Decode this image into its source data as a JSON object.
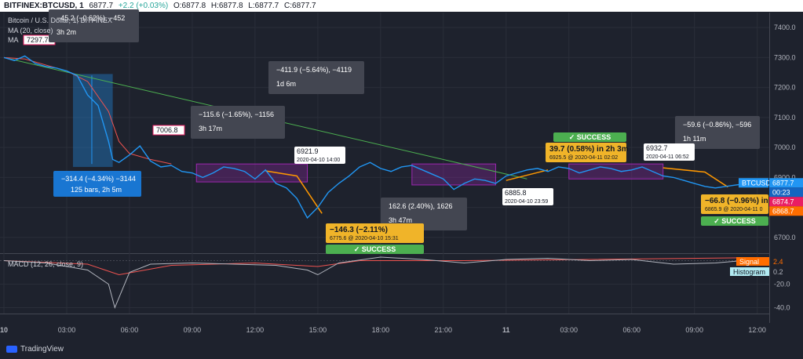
{
  "header": {
    "symbol": "BITFINEX:BTCUSD, 1",
    "last": "6877.7",
    "change": "+2.2 (+0.03%)",
    "o_label": "O:",
    "o": "6877.8",
    "h_label": "H:",
    "h": "6877.8",
    "l_label": "L:",
    "l": "6877.7",
    "c_label": "C:",
    "c": "6877.7"
  },
  "legend": {
    "title": "Bitcoin / U.S. Dollar, 1, BITFINEX",
    "ma1": "MA (20, close)",
    "ma2": "MA"
  },
  "macd_legend": "MACD (12, 26, close, 9)",
  "branding": "TradingView",
  "colors": {
    "background": "#1e222d",
    "price": "#2196f3",
    "ma_red": "#ef5350",
    "ma_orange": "#ff9800",
    "trend_green": "#4caf50",
    "rect_purple": "#9c27b0",
    "success": "#4caf50",
    "callout_yellow": "#f0b429",
    "measure_blue": "#1976d2"
  },
  "chart_data": [
    {
      "type": "line",
      "title": "Bitcoin / U.S. Dollar, 1, BITFINEX",
      "xlabel": "",
      "ylabel": "",
      "x_ticks": [
        "10",
        "03:00",
        "06:00",
        "09:00",
        "12:00",
        "15:00",
        "18:00",
        "21:00",
        "11",
        "03:00",
        "06:00",
        "09:00",
        "12:00"
      ],
      "y_ticks": [
        6700,
        6800,
        6900,
        7000,
        7100,
        7200,
        7300,
        7400
      ],
      "ylim": [
        6650,
        7450
      ],
      "xlim": [
        0,
        36.5
      ],
      "grid": true,
      "series": [
        {
          "name": "BTCUSD",
          "x": [
            0,
            0.5,
            1,
            1.5,
            2,
            2.5,
            3,
            3.5,
            4,
            4.5,
            5,
            5.2,
            5.5,
            6,
            6.5,
            7,
            7.5,
            8,
            8.5,
            9,
            9.5,
            10,
            10.5,
            11,
            11.5,
            12,
            12.5,
            13,
            13.5,
            14,
            14.5,
            15,
            15.5,
            16,
            16.5,
            17,
            17.5,
            18,
            18.5,
            19,
            19.5,
            20,
            20.5,
            21,
            21.5,
            22,
            22.5,
            23,
            23.5,
            24,
            24.5,
            25,
            25.5,
            26,
            26.5,
            27,
            27.5,
            28,
            28.5,
            29,
            29.5,
            30,
            30.5,
            31,
            31.5,
            32,
            32.5,
            33,
            33.5,
            34,
            34.5,
            35,
            35.3
          ],
          "values": [
            7300,
            7290,
            7305,
            7280,
            7270,
            7265,
            7255,
            7240,
            7175,
            7140,
            7020,
            6960,
            6950,
            6975,
            7005,
            6955,
            6935,
            6940,
            6920,
            6915,
            6900,
            6915,
            6935,
            6930,
            6920,
            6895,
            6925,
            6880,
            6865,
            6830,
            6765,
            6800,
            6850,
            6880,
            6905,
            6935,
            6950,
            6930,
            6920,
            6935,
            6940,
            6925,
            6910,
            6895,
            6860,
            6880,
            6895,
            6890,
            6880,
            6905,
            6915,
            6925,
            6930,
            6920,
            6935,
            6930,
            6915,
            6925,
            6935,
            6930,
            6920,
            6925,
            6935,
            6920,
            6905,
            6900,
            6890,
            6880,
            6870,
            6865,
            6870,
            6875,
            6877.7
          ]
        },
        {
          "name": "MA (20, close)",
          "x": [
            0,
            1,
            2,
            3,
            4,
            5,
            5.5,
            6,
            7,
            8
          ],
          "values": [
            7300,
            7295,
            7275,
            7255,
            7220,
            7120,
            7020,
            6980,
            6960,
            6945
          ]
        }
      ],
      "price_labels": [
        "7297.7",
        "7006.8",
        "6921.9",
        "6775.6",
        "6885.8",
        "6925.5",
        "6932.7",
        "6865.9"
      ],
      "right_labels": {
        "symbol": "BTCUSD",
        "price": "6877.7",
        "countdown": "00:23",
        "red": "6874.7",
        "orange": "6868.7"
      },
      "annotations": [
        {
          "line1": "−45.2 (−0.62%), −452",
          "line2": "3h 2m"
        },
        {
          "line1": "−314.4 (−4.34%) −3144",
          "line2": "125 bars, 2h 5m"
        },
        {
          "line1": "−411.9 (−5.64%), −4119",
          "line2": "1d 6m"
        },
        {
          "line1": "−115.6 (−1.65%), −1156",
          "line2": "3h 17m"
        },
        {
          "line1": "162.6 (2.40%), 1626",
          "line2": "3h 47m"
        },
        {
          "line1": "−59.6 (−0.86%), −596",
          "line2": "1h 11m"
        },
        {
          "line1": "−146.3 (−2.11%)",
          "line2": "6775.6 @ 2020-04-10 15:31"
        },
        {
          "line1": "39.7 (0.58%) in 2h 3m",
          "line2": "6925.5 @ 2020-04-11 02:02"
        },
        {
          "line1": "−66.8 (−0.96%) in",
          "line2": "6865.9 @ 2020-04-11 0"
        },
        {
          "line1": "6921.9",
          "line2": "2020-04-10 14:00"
        },
        {
          "line1": "6885.8",
          "line2": "2020-04-10 23:59"
        },
        {
          "line1": "6932.7",
          "line2": "2020-04-11 06:52"
        }
      ],
      "success_label": "✓ SUCCESS"
    },
    {
      "type": "line",
      "title": "MACD (12, 26, close, 9)",
      "y_ticks": [
        -20,
        -40
      ],
      "ylim": [
        -45,
        5
      ],
      "legend": [
        {
          "name": "Signal",
          "value": "2.4"
        },
        {
          "name": "Histogram",
          "value": "0.2"
        }
      ],
      "series": [
        {
          "name": "MACD",
          "x": [
            0,
            2,
            4,
            5,
            5.3,
            6,
            7,
            9,
            11,
            13,
            14.5,
            15,
            16,
            18,
            20,
            22,
            24,
            26,
            28,
            30,
            32,
            34,
            35.3
          ],
          "values": [
            0,
            -2,
            -8,
            -20,
            -40,
            -10,
            -3,
            -2,
            -3,
            -4,
            -8,
            -12,
            -2,
            3,
            1,
            -2,
            1,
            2,
            0,
            1,
            -3,
            -2,
            0
          ]
        },
        {
          "name": "Signal",
          "x": [
            0,
            4,
            5.5,
            8,
            12,
            15,
            17,
            22,
            28,
            35.3
          ],
          "values": [
            0,
            -3,
            -12,
            -4,
            -2,
            -5,
            0,
            0,
            1,
            2.4
          ]
        }
      ]
    }
  ]
}
